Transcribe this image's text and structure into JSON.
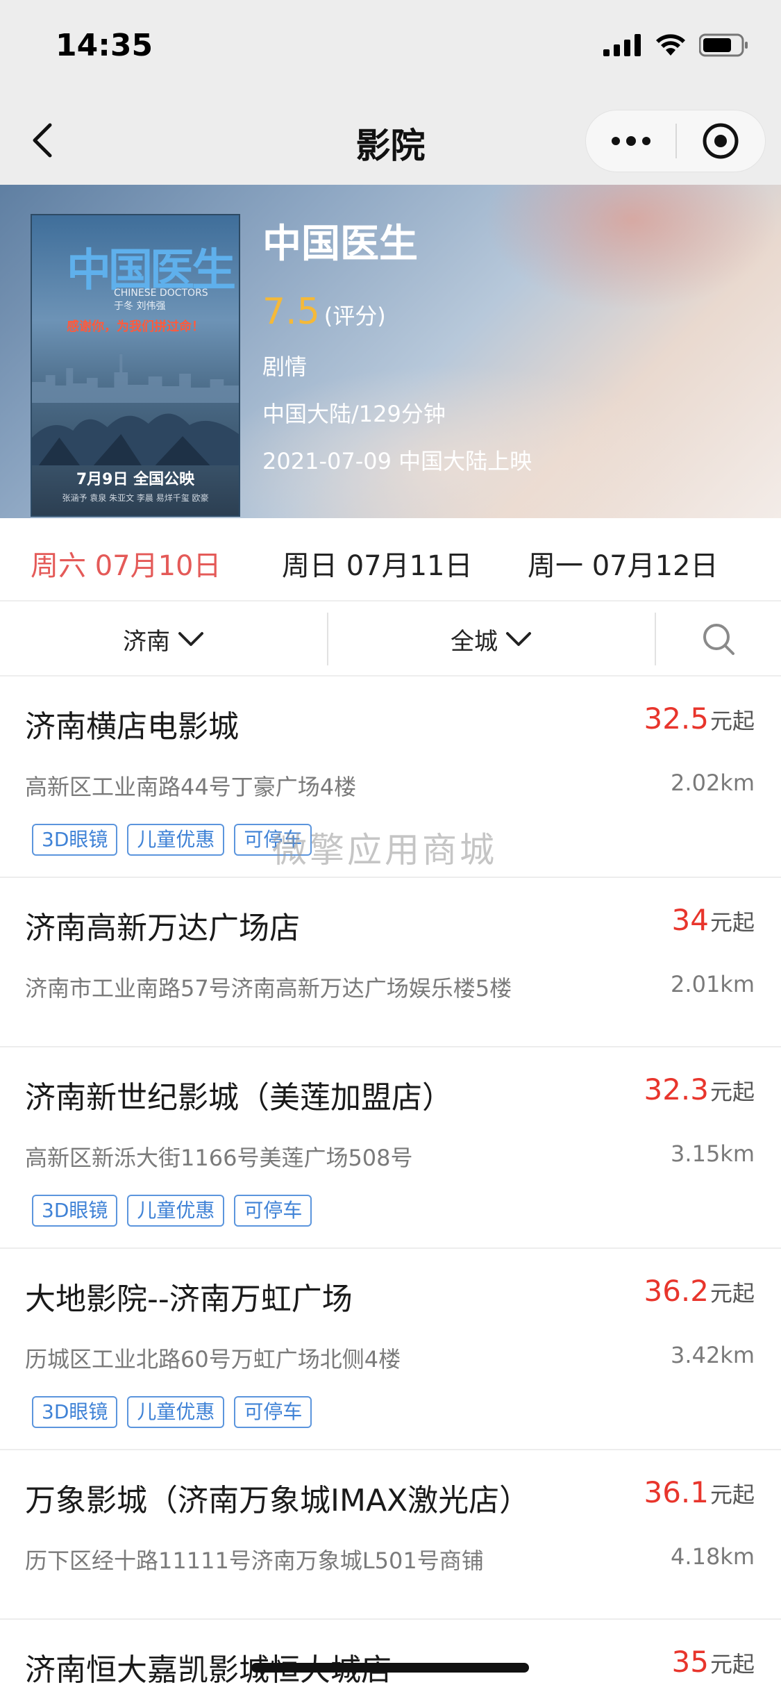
{
  "status_bar": {
    "time": "14:35"
  },
  "nav": {
    "title": "影院"
  },
  "movie": {
    "title": "中国医生",
    "poster": {
      "title": "中国医生",
      "subtitle": "CHINESE DOCTORS",
      "cast": "于冬  刘伟强",
      "slogan": "感谢你，为我们拼过命！",
      "date": "7月9日 全国公映",
      "credits": "张涵予 袁泉 朱亚文 李晨 易烊千玺 欧豪"
    },
    "score": "7.5",
    "score_label": "(评分)",
    "genre": "剧情",
    "meta": "中国大陆/129分钟",
    "release": "2021-07-09 中国大陆上映"
  },
  "date_tabs": [
    {
      "label": "周六 07月10日",
      "active": true
    },
    {
      "label": "周日 07月11日",
      "active": false
    },
    {
      "label": "周一 07月12日",
      "active": false
    }
  ],
  "filters": {
    "city": "济南",
    "district": "全城"
  },
  "cinemas": [
    {
      "name": "济南横店电影城",
      "price": "32.5",
      "unit": "元起",
      "address": "高新区工业南路44号丁豪广场4楼",
      "distance": "2.02km",
      "tags": [
        "3D眼镜",
        "儿童优惠",
        "可停车"
      ]
    },
    {
      "name": "济南高新万达广场店",
      "price": "34",
      "unit": "元起",
      "address": "济南市工业南路57号济南高新万达广场娱乐楼5楼",
      "distance": "2.01km",
      "tags": []
    },
    {
      "name": "济南新世纪影城（美莲加盟店）",
      "price": "32.3",
      "unit": "元起",
      "address": "高新区新泺大街1166号美莲广场508号",
      "distance": "3.15km",
      "tags": [
        "3D眼镜",
        "儿童优惠",
        "可停车"
      ]
    },
    {
      "name": "大地影院--济南万虹广场",
      "price": "36.2",
      "unit": "元起",
      "address": "历城区工业北路60号万虹广场北侧4楼",
      "distance": "3.42km",
      "tags": [
        "3D眼镜",
        "儿童优惠",
        "可停车"
      ]
    },
    {
      "name": "万象影城（济南万象城IMAX激光店）",
      "price": "36.1",
      "unit": "元起",
      "address": "历下区经十路11111号济南万象城L501号商铺",
      "distance": "4.18km",
      "tags": []
    },
    {
      "name": "济南恒大嘉凯影城恒大城店",
      "price": "35",
      "unit": "元起",
      "address": "",
      "distance": "",
      "tags": []
    }
  ],
  "watermark": "微擎应用商城",
  "colors": {
    "active_date": "#e45a58",
    "price": "#e8352c",
    "score": "#f5b938",
    "tag": "#3f82d6"
  }
}
